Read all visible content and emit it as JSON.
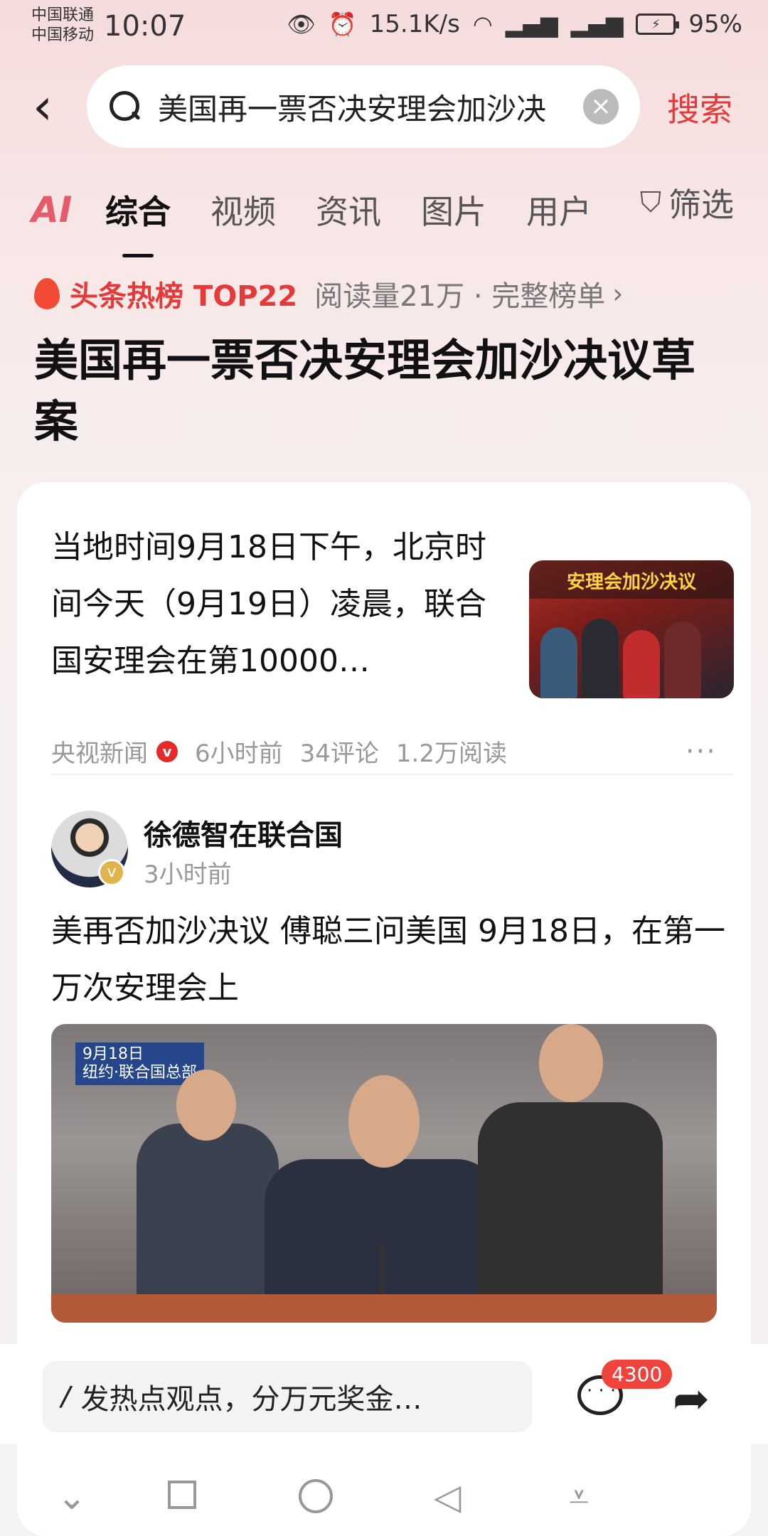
{
  "status_bar": {
    "carrier1": "中国联通",
    "carrier2": "中国移动",
    "time": "10:07",
    "speed": "15.1K/s",
    "battery": "95%",
    "icons": [
      "eye-icon",
      "alarm-icon",
      "wifi-icon",
      "signal-4g-icon",
      "signal-4g-icon",
      "battery-icon"
    ]
  },
  "search": {
    "query": "美国再一票否决安理会加沙决",
    "button": "搜索"
  },
  "tabs": {
    "ai": "AI",
    "items": [
      "综合",
      "视频",
      "资讯",
      "图片",
      "用户"
    ],
    "filter": "筛选"
  },
  "hot": {
    "label": "头条热榜 TOP22",
    "reads": "阅读量21万 · 完整榜单"
  },
  "headline": "美国再一票否决安理会加沙决议草案",
  "article": {
    "text": "当地时间9月18日下午，北京时间今天（9月19日）凌晨，联合国安理会在第10000…",
    "thumb_caption": "安理会加沙决议",
    "source": "央视新闻",
    "time": "6小时前",
    "comments": "34评论",
    "reads": "1.2万阅读"
  },
  "post": {
    "author": "徐德智在联合国",
    "time": "3小时前",
    "text": "美再否加沙决议 傅聪三问美国 9月18日，在第一万次安理会上",
    "video_tag_line1": "9月18日",
    "video_tag_line2": "纽约·联合国总部"
  },
  "bottom": {
    "comment_placeholder": "发热点观点，分万元奖金…",
    "comment_count": "4300"
  },
  "colors": {
    "accent_red": "#e43a3a",
    "badge_red": "#f0433b"
  }
}
